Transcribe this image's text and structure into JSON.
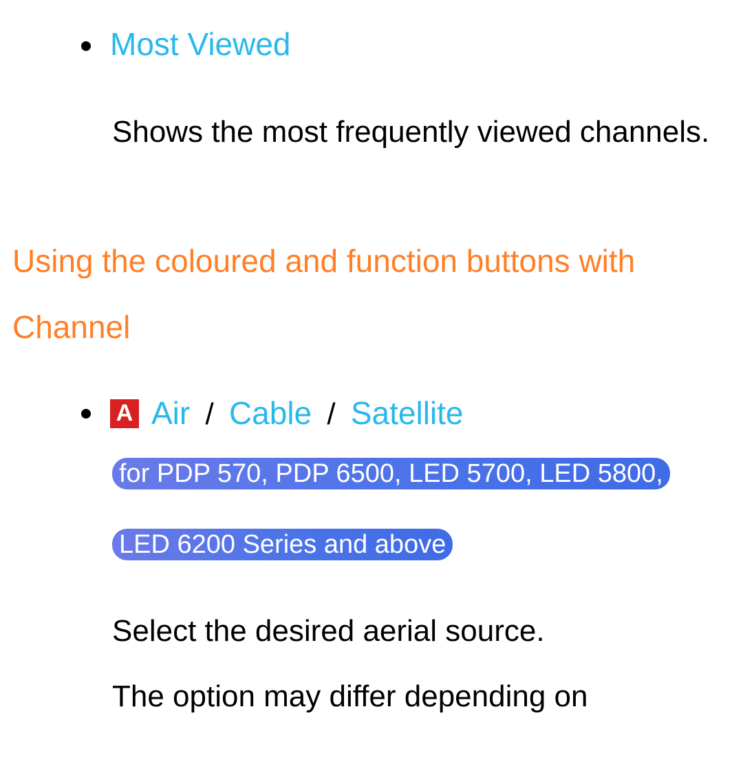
{
  "item1": {
    "title": "Most Viewed",
    "description": "Shows the most frequently viewed channels."
  },
  "section_heading": "Using the coloured and function buttons with Channel",
  "item2": {
    "button_label": "A",
    "source1": "Air",
    "source2": "Cable",
    "source3": "Satellite",
    "series_note": "for PDP 570, PDP 6500, LED 5700, LED 5800, LED 6200 Series and above",
    "desc_line1": "Select the desired aerial source.",
    "desc_line2": "The option may differ depending on"
  }
}
